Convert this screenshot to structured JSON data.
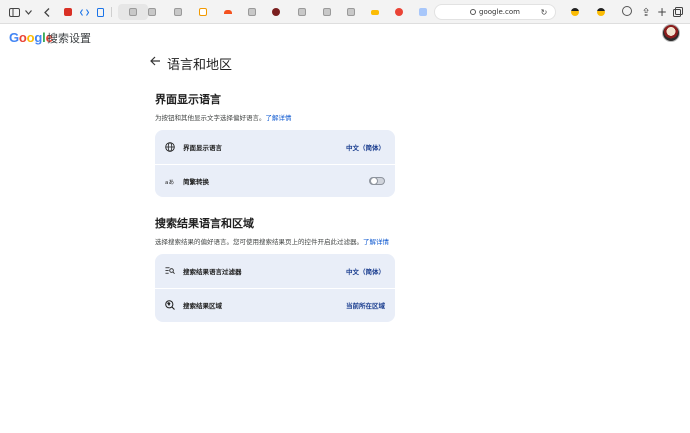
{
  "browser": {
    "address": "google.com"
  },
  "header": {
    "logo_letters": [
      "G",
      "o",
      "o",
      "g",
      "l",
      "e"
    ],
    "logo_colors": [
      "#4285F4",
      "#EA4335",
      "#FBBC05",
      "#4285F4",
      "#34A853",
      "#EA4335"
    ],
    "app_title": "搜索设置"
  },
  "page": {
    "title": "语言和地区"
  },
  "display_language": {
    "heading": "界面显示语言",
    "description": "为按钮和其他显示文字选择偏好语言。",
    "learn_more": "了解详情",
    "rows": [
      {
        "icon": "globe-icon",
        "label": "界面显示语言",
        "value": "中文（简体）"
      },
      {
        "icon": "translate-icon",
        "label": "简繁转换",
        "toggle": false
      }
    ]
  },
  "results": {
    "heading": "搜索结果语言和区域",
    "description": "选择搜索结果的偏好语言。您可使用搜索结果页上的控件开启此过滤器。",
    "learn_more": "了解详情",
    "rows": [
      {
        "icon": "filter-language-icon",
        "label": "搜索结果语言过滤器",
        "value": "中文（简体）"
      },
      {
        "icon": "region-search-icon",
        "label": "搜索结果区域",
        "value": "当前所在区域"
      }
    ]
  }
}
